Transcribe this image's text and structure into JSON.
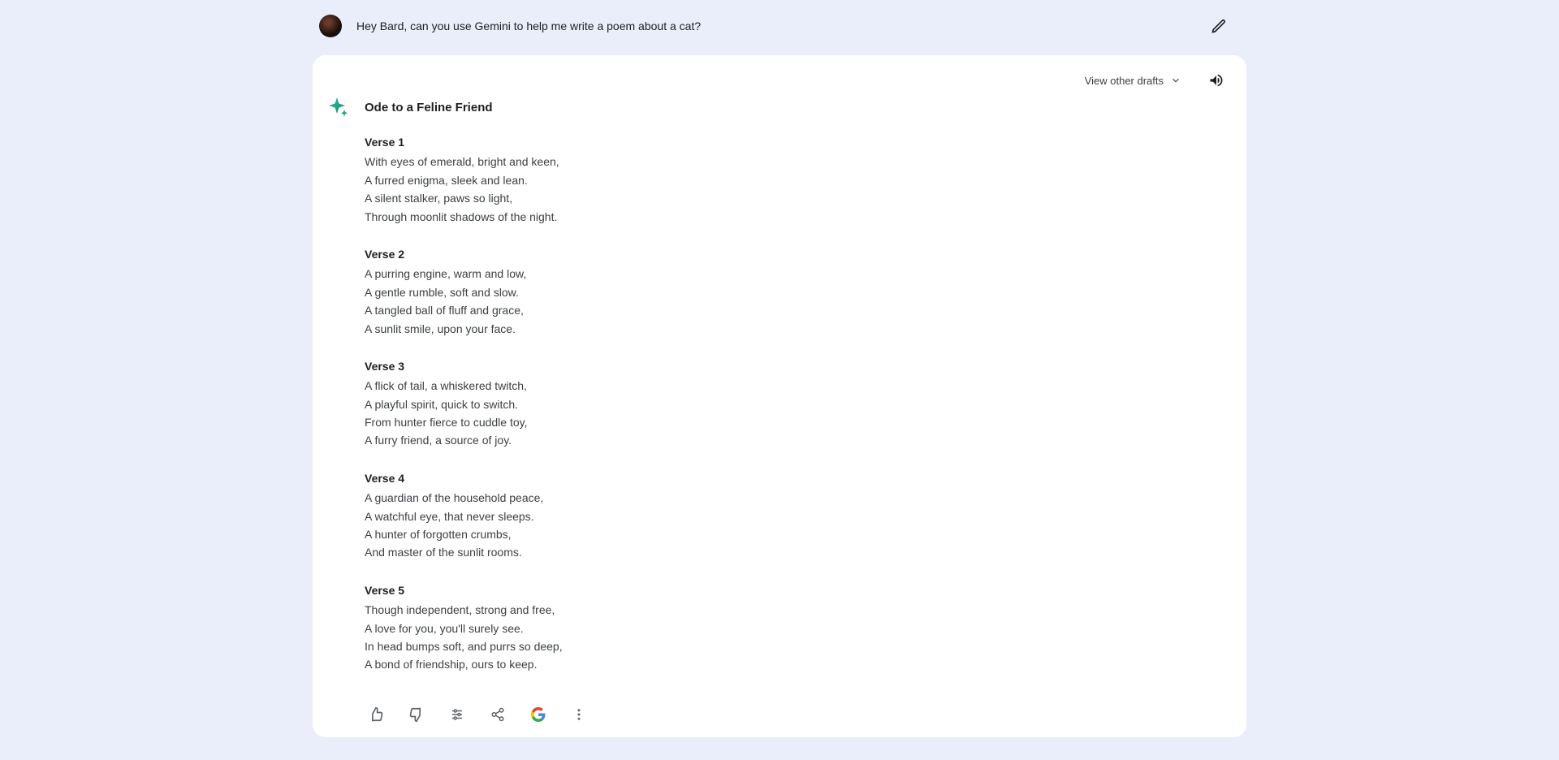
{
  "prompt": {
    "text": "Hey Bard, can you use Gemini to help me write a poem about a cat?"
  },
  "topbar": {
    "drafts_label": "View other drafts"
  },
  "response": {
    "title": "Ode to a Feline Friend",
    "verses": [
      {
        "label": "Verse 1",
        "lines": [
          "With eyes of emerald, bright and keen,",
          "A furred enigma, sleek and lean.",
          "A silent stalker, paws so light,",
          "Through moonlit shadows of the night."
        ]
      },
      {
        "label": "Verse 2",
        "lines": [
          "A purring engine, warm and low,",
          "A gentle rumble, soft and slow.",
          "A tangled ball of fluff and grace,",
          "A sunlit smile, upon your face."
        ]
      },
      {
        "label": "Verse 3",
        "lines": [
          "A flick of tail, a whiskered twitch,",
          "A playful spirit, quick to switch.",
          "From hunter fierce to cuddle toy,",
          "A furry friend, a source of joy."
        ]
      },
      {
        "label": "Verse 4",
        "lines": [
          "A guardian of the household peace,",
          "A watchful eye, that never sleeps.",
          "A hunter of forgotten crumbs,",
          "And master of the sunlit rooms."
        ]
      },
      {
        "label": "Verse 5",
        "lines": [
          "Though independent, strong and free,",
          "A love for you, you'll surely see.",
          "In head bumps soft, and purrs so deep,",
          "A bond of friendship, ours to keep."
        ]
      }
    ]
  }
}
